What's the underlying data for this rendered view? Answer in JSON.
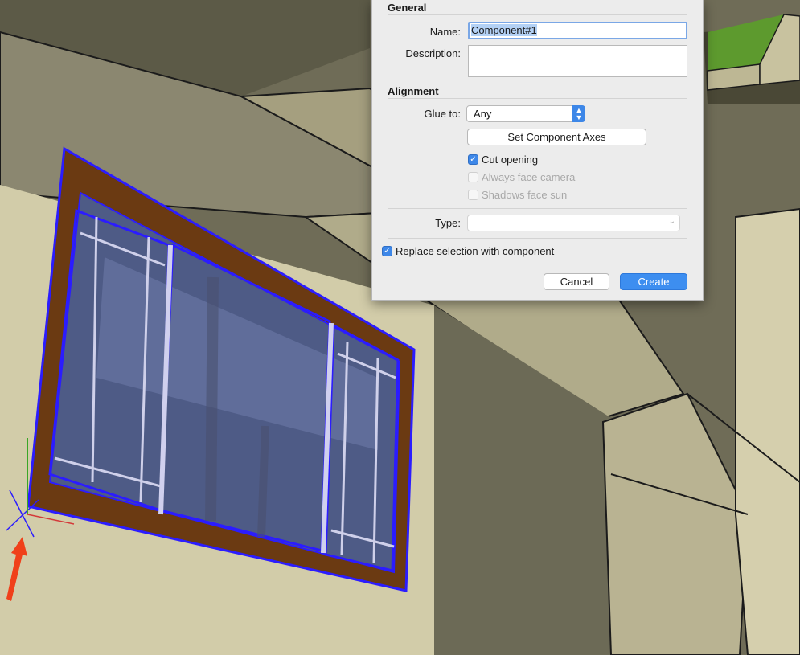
{
  "dialog": {
    "general_heading": "General",
    "name_label": "Name:",
    "name_value": "Component#1",
    "description_label": "Description:",
    "description_value": "",
    "alignment_heading": "Alignment",
    "glue_label": "Glue to:",
    "glue_value": "Any",
    "set_axes_label": "Set Component Axes",
    "cut_opening_label": "Cut opening",
    "cut_opening_checked": true,
    "always_face_camera_label": "Always face camera",
    "always_face_camera_checked": false,
    "shadows_face_sun_label": "Shadows face sun",
    "shadows_face_sun_checked": false,
    "type_label": "Type:",
    "type_value": "",
    "replace_label": "Replace selection with component",
    "replace_checked": true,
    "cancel_label": "Cancel",
    "create_label": "Create"
  },
  "colors": {
    "accent": "#3d87e8",
    "selection": "#2b1cff",
    "annotation_arrow": "#f0401a"
  },
  "icons": [
    "checkmark-icon",
    "stepper-icon",
    "dropdown-arrow-icon",
    "axes-icon",
    "red-arrow-icon"
  ]
}
